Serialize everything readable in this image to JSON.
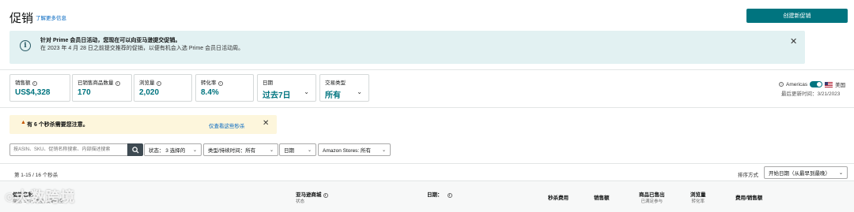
{
  "header": {
    "title": "促销",
    "learn_more": "了解更多信息",
    "create_button": "创建新促销"
  },
  "banner": {
    "title": "针对 Prime 会员日活动，您现在可以向亚马逊提交促销。",
    "text": "在 2023 年 4 月 28 日之前提交推荐的促销，以便有机会入选 Prime 会员日活动周。"
  },
  "metrics": [
    {
      "label": "销售额",
      "value": "US$4,328",
      "info": true
    },
    {
      "label": "已销售商品数量",
      "value": "170",
      "info": true
    },
    {
      "label": "浏览量",
      "value": "2,020",
      "info": true
    },
    {
      "label": "转化率",
      "value": "8.4%",
      "info": true
    },
    {
      "label": "日期",
      "value": "过去7日",
      "dropdown": true
    },
    {
      "label": "交易类型",
      "value": "所有",
      "dropdown": true
    }
  ],
  "region": {
    "label": "Americas",
    "country": "美国",
    "updated": "最后更新时间：3/21/2023"
  },
  "warning": {
    "text": "有 6 个秒杀需要您注意。",
    "link": "仅查看这些秒杀"
  },
  "filters": {
    "search_placeholder": "按ASIN、SKU、促销名称搜索、内部描述搜索",
    "status": "状态： 3 选择的",
    "type": "类型/持续时间：所有",
    "date": "日期",
    "stores": "Amazon Stores: 所有"
  },
  "list": {
    "count": "第 1-15 / 16 个秒杀",
    "sort_label": "排序方式",
    "sort_value": "开始日期（从最早到最晚）"
  },
  "table": {
    "columns": [
      {
        "label": "促销名称",
        "sub": "描述, SKU, 类型, 促销类型"
      },
      {
        "label": "亚马逊商城",
        "sub": "状态",
        "info": true
      },
      {
        "label": "日期：",
        "sub": "",
        "info": true
      },
      {
        "label": "秒杀费用",
        "sub": ""
      },
      {
        "label": "销售额",
        "sub": ""
      },
      {
        "label": "商品已售出",
        "sub": "已满足参与"
      },
      {
        "label": "浏览量",
        "sub": "转化率"
      },
      {
        "label": "费用/销售额",
        "sub": ""
      }
    ]
  },
  "watermark": "大数跨境",
  "colors": {
    "accent": "#00747f",
    "banner_bg": "#e2f1f2",
    "warning_bg": "#fdf6dc",
    "link": "#0066c0"
  }
}
